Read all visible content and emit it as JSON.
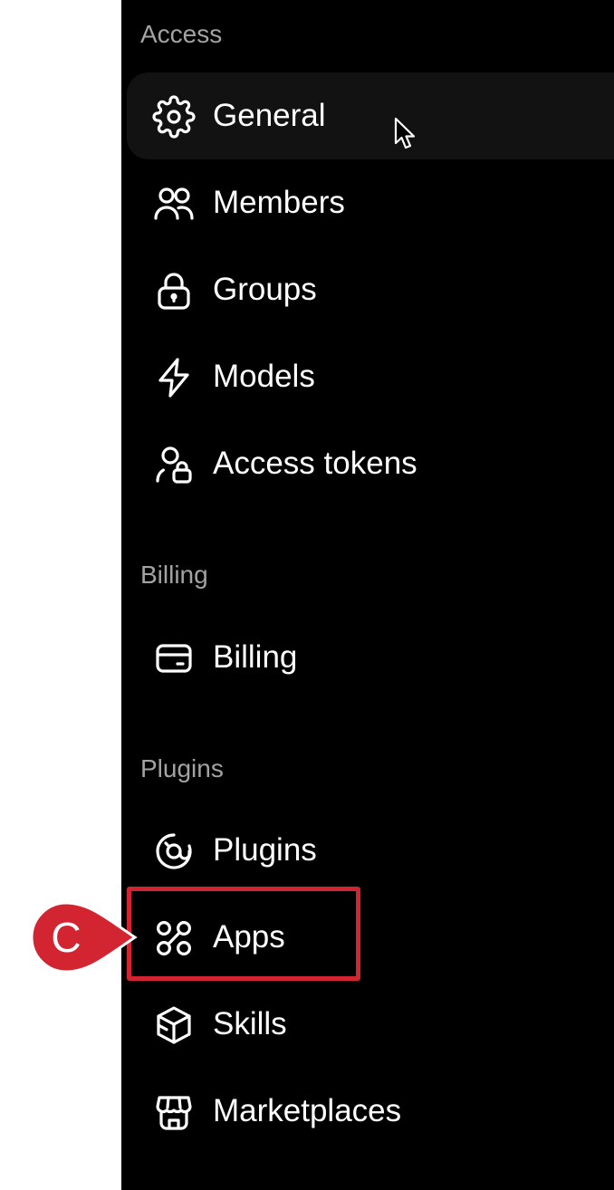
{
  "sections": [
    {
      "label": "Access",
      "items": [
        {
          "label": "General",
          "icon": "gear-icon",
          "active": true
        },
        {
          "label": "Members",
          "icon": "users-icon"
        },
        {
          "label": "Groups",
          "icon": "lock-icon"
        },
        {
          "label": "Models",
          "icon": "lightning-icon"
        },
        {
          "label": "Access tokens",
          "icon": "user-lock-icon"
        }
      ]
    },
    {
      "label": "Billing",
      "items": [
        {
          "label": "Billing",
          "icon": "credit-card-icon"
        }
      ]
    },
    {
      "label": "Plugins",
      "items": [
        {
          "label": "Plugins",
          "icon": "plugin-icon"
        },
        {
          "label": "Apps",
          "icon": "apps-icon",
          "highlighted": true
        },
        {
          "label": "Skills",
          "icon": "cube-icon"
        },
        {
          "label": "Marketplaces",
          "icon": "storefront-icon"
        }
      ]
    }
  ],
  "annotation": {
    "letter": "C",
    "color": "#d32531"
  }
}
